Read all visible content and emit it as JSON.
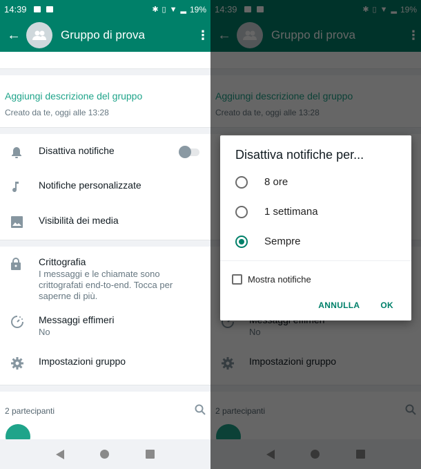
{
  "status_bar": {
    "time": "14:39",
    "battery": "19%"
  },
  "app_bar": {
    "title": "Gruppo di prova",
    "back_icon": "arrow-left-icon",
    "menu_icon": "more-vert-icon",
    "avatar_icon": "group-icon"
  },
  "description": {
    "link": "Aggiungi descrizione del gruppo",
    "created": "Creato da te, oggi alle 13:28"
  },
  "settings": [
    {
      "icon": "bell-icon",
      "label": "Disattiva notifiche",
      "toggle": false
    },
    {
      "icon": "music-note-icon",
      "label": "Notifiche personalizzate"
    },
    {
      "icon": "image-icon",
      "label": "Visibilità dei media"
    }
  ],
  "security": [
    {
      "icon": "lock-icon",
      "label": "Crittografia",
      "sub": "I messaggi e le chiamate sono crittografati end-to-end. Tocca per saperne di più."
    },
    {
      "icon": "timer-icon",
      "label": "Messaggi effimeri",
      "sub": "No"
    },
    {
      "icon": "gear-icon",
      "label": "Impostazioni gruppo"
    }
  ],
  "participants": {
    "header": "2 partecipanti",
    "search_icon": "search-icon"
  },
  "dialog": {
    "title": "Disattiva notifiche per...",
    "options": [
      {
        "label": "8 ore",
        "selected": false
      },
      {
        "label": "1 settimana",
        "selected": false
      },
      {
        "label": "Sempre",
        "selected": true
      }
    ],
    "checkbox_label": "Mostra notifiche",
    "checkbox_checked": false,
    "cancel": "ANNULLA",
    "ok": "OK"
  },
  "colors": {
    "primary": "#008069",
    "accent_link": "#1fa48a"
  }
}
